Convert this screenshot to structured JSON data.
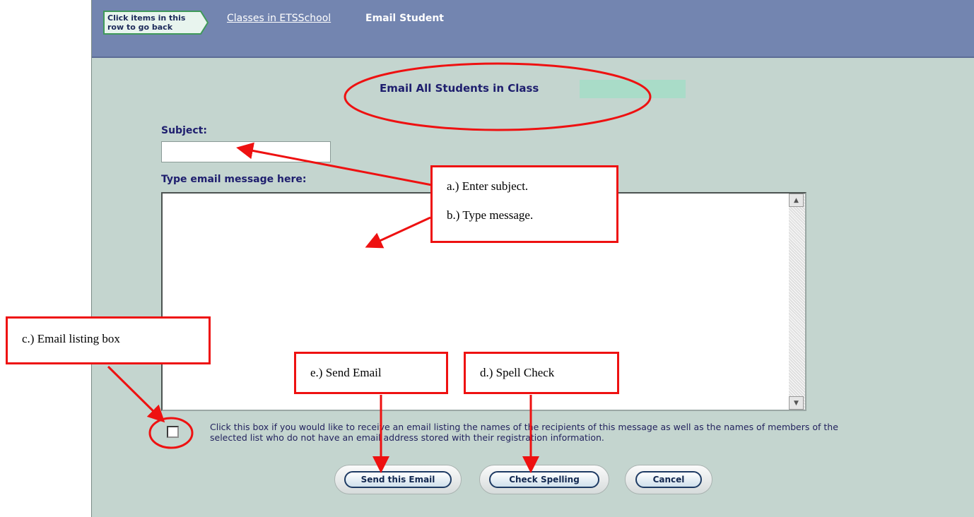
{
  "breadcrumb": {
    "back_hint": "Click items in this row to go back",
    "link": "Classes in ETSSchool",
    "current": "Email Student"
  },
  "page": {
    "title": "Email All Students in Class"
  },
  "form": {
    "subject_label": "Subject:",
    "subject_value": "",
    "message_label": "Type email message here:",
    "message_value": "",
    "listing_checkbox_checked": false,
    "listing_note": "Click this box if you would like to receive an email listing the names of the recipients of this message as well as the names of members of the selected list who do not have an email address stored with their registration information."
  },
  "buttons": {
    "send": "Send this Email",
    "spell": "Check Spelling",
    "cancel": "Cancel"
  },
  "annotations": {
    "a": "a.) Enter subject.",
    "b": "b.) Type message.",
    "c": "c.) Email listing box",
    "d": "d.) Spell Check",
    "e": "e.) Send Email"
  },
  "colors": {
    "annotation_red": "#ee1111",
    "header_blue": "#7385b0",
    "content_bg": "#c4d5cf",
    "label_navy": "#1e1e6e"
  }
}
